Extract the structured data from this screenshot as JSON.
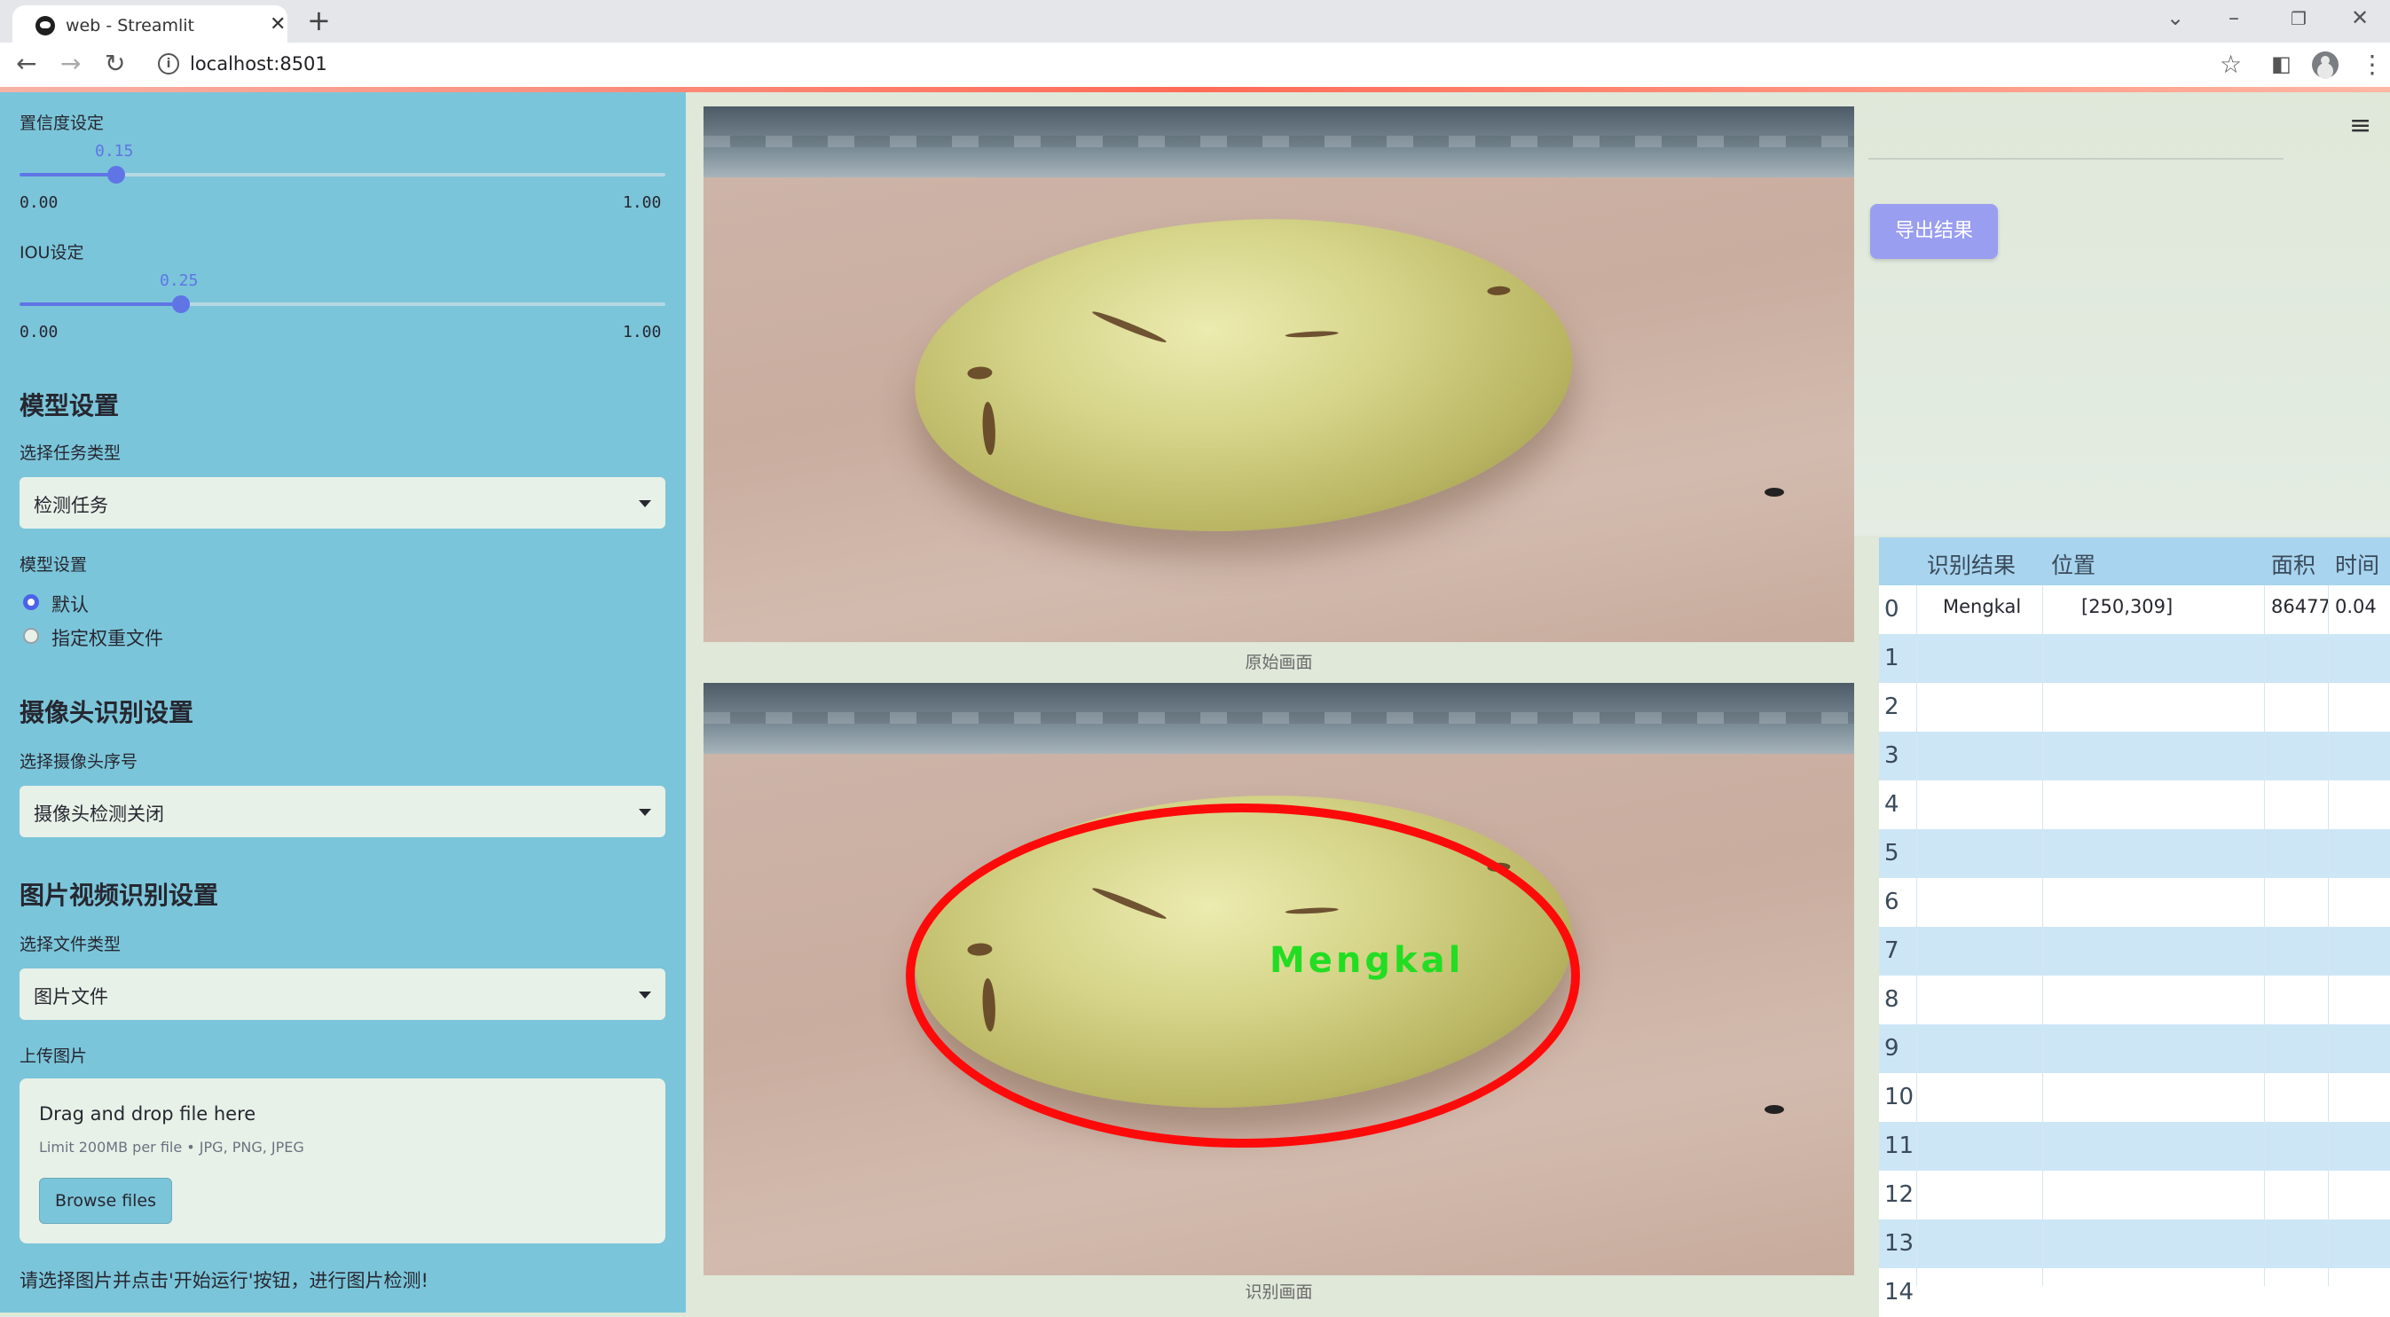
{
  "browser": {
    "tab_title": "web - Streamlit",
    "url": "localhost:8501"
  },
  "sidebar": {
    "confidence": {
      "label": "置信度设定",
      "value": "0.15",
      "min": "0.00",
      "max": "1.00",
      "fraction": 0.15
    },
    "iou": {
      "label": "IOU设定",
      "value": "0.25",
      "min": "0.00",
      "max": "1.00",
      "fraction": 0.25
    },
    "model_section": {
      "heading": "模型设置",
      "task_label": "选择任务类型",
      "task_value": "检测任务",
      "weights_label": "模型设置",
      "radio_options": [
        "默认",
        "指定权重文件"
      ],
      "radio_selected": 0
    },
    "camera_section": {
      "heading": "摄像头识别设置",
      "camera_label": "选择摄像头序号",
      "camera_value": "摄像头检测关闭"
    },
    "media_section": {
      "heading": "图片视频识别设置",
      "file_type_label": "选择文件类型",
      "file_type_value": "图片文件",
      "upload_label": "上传图片",
      "drop_text": "Drag and drop file here",
      "limit_text": "Limit 200MB per file • JPG, PNG, JPEG",
      "browse_label": "Browse files"
    },
    "footer_text": "请选择图片并点击'开始运行'按钮，进行图片检测!"
  },
  "main": {
    "original_caption": "原始画面",
    "result_caption": "识别画面",
    "detection_label": "Mengkal",
    "detection_color": "#ff0a0a",
    "label_color": "#22dd22"
  },
  "right": {
    "export_label": "导出结果",
    "table": {
      "columns": [
        "识别结果",
        "位置",
        "面积",
        "时间"
      ],
      "rows": [
        {
          "index": "0",
          "result": "Mengkal",
          "position": "[250,309]",
          "area": "86477",
          "time": "0.04"
        },
        {
          "index": "1",
          "result": "",
          "position": "",
          "area": "",
          "time": ""
        },
        {
          "index": "2",
          "result": "",
          "position": "",
          "area": "",
          "time": ""
        },
        {
          "index": "3",
          "result": "",
          "position": "",
          "area": "",
          "time": ""
        },
        {
          "index": "4",
          "result": "",
          "position": "",
          "area": "",
          "time": ""
        },
        {
          "index": "5",
          "result": "",
          "position": "",
          "area": "",
          "time": ""
        },
        {
          "index": "6",
          "result": "",
          "position": "",
          "area": "",
          "time": ""
        },
        {
          "index": "7",
          "result": "",
          "position": "",
          "area": "",
          "time": ""
        },
        {
          "index": "8",
          "result": "",
          "position": "",
          "area": "",
          "time": ""
        },
        {
          "index": "9",
          "result": "",
          "position": "",
          "area": "",
          "time": ""
        },
        {
          "index": "10",
          "result": "",
          "position": "",
          "area": "",
          "time": ""
        },
        {
          "index": "11",
          "result": "",
          "position": "",
          "area": "",
          "time": ""
        },
        {
          "index": "12",
          "result": "",
          "position": "",
          "area": "",
          "time": ""
        },
        {
          "index": "13",
          "result": "",
          "position": "",
          "area": "",
          "time": ""
        },
        {
          "index": "14",
          "result": "",
          "position": "",
          "area": "",
          "time": ""
        }
      ]
    }
  }
}
